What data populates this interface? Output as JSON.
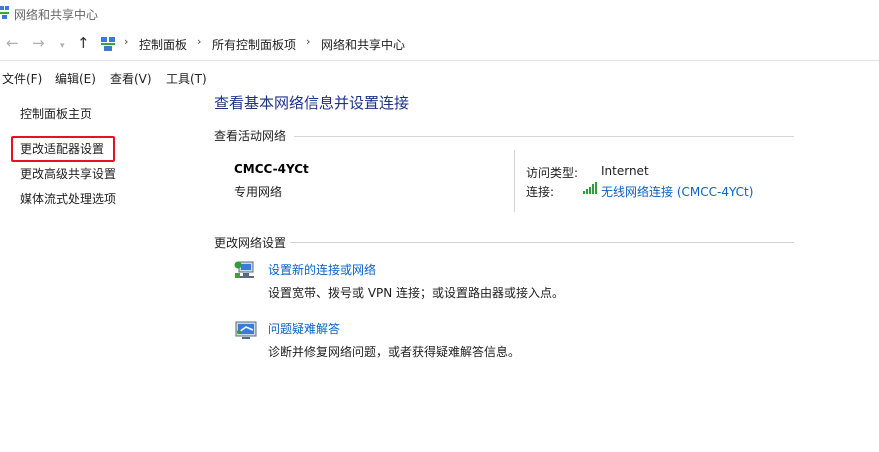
{
  "window": {
    "title": "网络和共享中心"
  },
  "nav": {
    "back_icon": "back-arrow-icon",
    "forward_icon": "forward-arrow-icon",
    "recent_icon": "chevron-down-icon",
    "up_icon": "up-arrow-icon",
    "breadcrumbs": [
      "控制面板",
      "所有控制面板项",
      "网络和共享中心"
    ],
    "separator": "›"
  },
  "menu": {
    "items": [
      "文件(F)",
      "编辑(E)",
      "查看(V)",
      "工具(T)"
    ]
  },
  "sidebar": {
    "home": "控制面板主页",
    "links": [
      "更改适配器设置",
      "更改高级共享设置",
      "媒体流式处理选项"
    ],
    "highlight_color": "#e81123"
  },
  "main": {
    "title": "查看基本网络信息并设置连接",
    "active_section": "查看活动网络",
    "network": {
      "name": "CMCC-4YCt",
      "type": "专用网络",
      "access_label": "访问类型:",
      "access_value": "Internet",
      "connection_label": "连接:",
      "connection_value": "无线网络连接 (CMCC-4YCt)",
      "connection_icon": "wifi-signal-icon"
    },
    "change_section": "更改网络设置",
    "tasks": [
      {
        "icon": "network-setup-icon",
        "link": "设置新的连接或网络",
        "desc": "设置宽带、拨号或 VPN 连接；或设置路由器或接入点。"
      },
      {
        "icon": "troubleshoot-icon",
        "link": "问题疑难解答",
        "desc": "诊断并修复网络问题，或者获得疑难解答信息。"
      }
    ]
  },
  "colors": {
    "link": "#0b61c4",
    "title": "#1e3287",
    "highlight": "#e81123"
  }
}
